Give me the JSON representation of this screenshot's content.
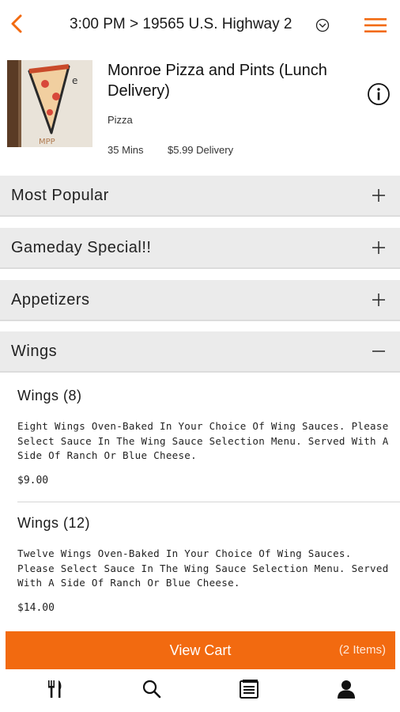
{
  "header": {
    "title": "3:00 PM > 19565 U.S. Highway 2",
    "back_icon": "chevron-left-icon",
    "dropdown_icon": "chevron-down-circle-icon",
    "menu_icon": "hamburger-menu-icon",
    "accent": "#f26a10"
  },
  "restaurant": {
    "name": "Monroe Pizza and Pints (Lunch Delivery)",
    "category": "Pizza",
    "time": "35 Mins",
    "delivery_fee": "$5.99 Delivery",
    "info_icon": "info-icon"
  },
  "categories": [
    {
      "label": "Most Popular",
      "toggle": "+"
    },
    {
      "label": "Gameday Special!!",
      "toggle": "+"
    },
    {
      "label": "Appetizers",
      "toggle": "+"
    },
    {
      "label": "Wings",
      "toggle": "−"
    }
  ],
  "items": [
    {
      "name": "Wings (8)",
      "description": "Eight Wings Oven-Baked In Your Choice Of Wing Sauces. Please Select Sauce In The Wing Sauce Selection Menu. Served With A Side Of Ranch Or Blue Cheese.",
      "price": "$9.00"
    },
    {
      "name": "Wings (12)",
      "description": "Twelve Wings Oven-Baked In Your Choice Of Wing Sauces. Please Select Sauce In The Wing Sauce Selection Menu. Served With A Side Of Ranch Or Blue Cheese.",
      "price": "$14.00"
    }
  ],
  "cart": {
    "label": "View Cart",
    "count": "(2 Items)",
    "color": "#f26a10"
  },
  "tabbar": {
    "items": [
      {
        "icon": "fork-knife-icon"
      },
      {
        "icon": "search-icon"
      },
      {
        "icon": "orders-list-icon"
      },
      {
        "icon": "user-profile-icon"
      }
    ]
  }
}
